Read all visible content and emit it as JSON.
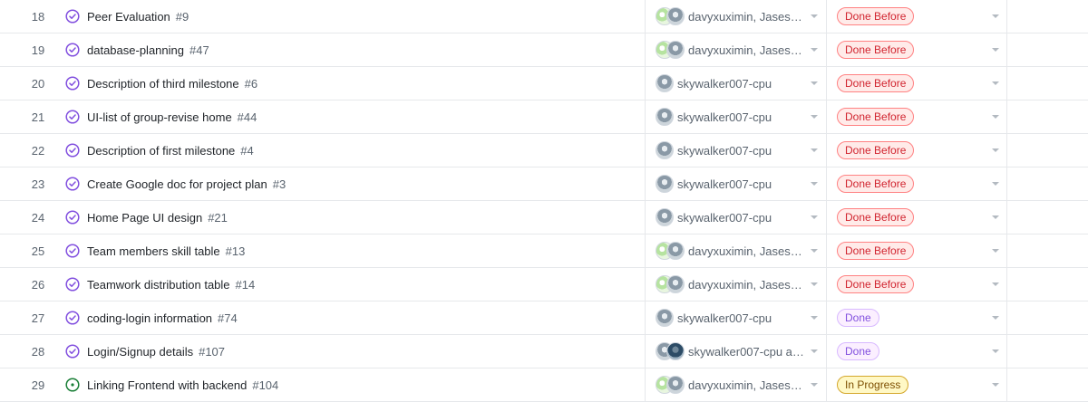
{
  "colors": {
    "closed_icon": "#8250df",
    "open_icon": "#1a7f37",
    "done_before": "#d1242f",
    "done": "#8250df",
    "in_progress": "#9a6700"
  },
  "rows": [
    {
      "num": "18",
      "title": "Peer Evaluation",
      "issue": "#9",
      "state": "closed",
      "avatars": [
        "av-green",
        "av-photo"
      ],
      "assignee": "davyxuximin, Jases…",
      "status": "Done Before",
      "status_kind": "b-done-before"
    },
    {
      "num": "19",
      "title": "database-planning",
      "issue": "#47",
      "state": "closed",
      "avatars": [
        "av-green",
        "av-photo"
      ],
      "assignee": "davyxuximin, Jases…",
      "status": "Done Before",
      "status_kind": "b-done-before"
    },
    {
      "num": "20",
      "title": "Description of third milestone",
      "issue": "#6",
      "state": "closed",
      "avatars": [
        "av-photo"
      ],
      "assignee": "skywalker007-cpu",
      "status": "Done Before",
      "status_kind": "b-done-before"
    },
    {
      "num": "21",
      "title": "UI-list of group-revise home",
      "issue": "#44",
      "state": "closed",
      "avatars": [
        "av-photo"
      ],
      "assignee": "skywalker007-cpu",
      "status": "Done Before",
      "status_kind": "b-done-before"
    },
    {
      "num": "22",
      "title": "Description of first milestone",
      "issue": "#4",
      "state": "closed",
      "avatars": [
        "av-photo"
      ],
      "assignee": "skywalker007-cpu",
      "status": "Done Before",
      "status_kind": "b-done-before"
    },
    {
      "num": "23",
      "title": "Create Google doc for project plan",
      "issue": "#3",
      "state": "closed",
      "avatars": [
        "av-photo"
      ],
      "assignee": "skywalker007-cpu",
      "status": "Done Before",
      "status_kind": "b-done-before"
    },
    {
      "num": "24",
      "title": "Home Page UI design",
      "issue": "#21",
      "state": "closed",
      "avatars": [
        "av-photo"
      ],
      "assignee": "skywalker007-cpu",
      "status": "Done Before",
      "status_kind": "b-done-before"
    },
    {
      "num": "25",
      "title": "Team members skill table",
      "issue": "#13",
      "state": "closed",
      "avatars": [
        "av-green",
        "av-photo"
      ],
      "assignee": "davyxuximin, Jases…",
      "status": "Done Before",
      "status_kind": "b-done-before"
    },
    {
      "num": "26",
      "title": "Teamwork distribution table",
      "issue": "#14",
      "state": "closed",
      "avatars": [
        "av-green",
        "av-photo"
      ],
      "assignee": "davyxuximin, Jases…",
      "status": "Done Before",
      "status_kind": "b-done-before"
    },
    {
      "num": "27",
      "title": "coding-login information",
      "issue": "#74",
      "state": "closed",
      "avatars": [
        "av-photo"
      ],
      "assignee": "skywalker007-cpu",
      "status": "Done",
      "status_kind": "b-done"
    },
    {
      "num": "28",
      "title": "Login/Signup details",
      "issue": "#107",
      "state": "closed",
      "avatars": [
        "av-photo",
        "av-dark"
      ],
      "assignee": "skywalker007-cpu a…",
      "status": "Done",
      "status_kind": "b-done"
    },
    {
      "num": "29",
      "title": "Linking Frontend with backend",
      "issue": "#104",
      "state": "open",
      "avatars": [
        "av-green",
        "av-photo"
      ],
      "assignee": "davyxuximin, Jases…",
      "status": "In Progress",
      "status_kind": "b-progress"
    }
  ]
}
